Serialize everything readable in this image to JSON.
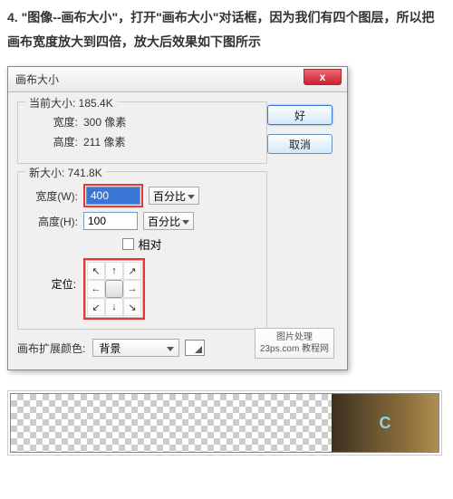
{
  "intro": "4. \"图像--画布大小\"，打开\"画布大小\"对话框，因为我们有四个图层，所以把画布宽度放大到四倍，放大后效果如下图所示",
  "dialog": {
    "title": "画布大小",
    "close": "x",
    "current": {
      "legend": "当前大小: 185.4K",
      "width_label": "宽度:",
      "width_value": "300 像素",
      "height_label": "高度:",
      "height_value": "211 像素"
    },
    "new": {
      "legend": "新大小: 741.8K",
      "width_label": "宽度(W):",
      "width_value": "400",
      "width_unit": "百分比",
      "height_label": "高度(H):",
      "height_value": "100",
      "height_unit": "百分比",
      "relative_label": "相对",
      "anchor_label": "定位:",
      "arrows": {
        "nw": "↖",
        "n": "↑",
        "ne": "↗",
        "w": "←",
        "e": "→",
        "sw": "↙",
        "s": "↓",
        "se": "↘"
      }
    },
    "extend": {
      "label": "画布扩展颜色:",
      "value": "背景"
    },
    "buttons": {
      "ok": "好",
      "cancel": "取消"
    },
    "watermark": {
      "line1": "图片处理",
      "line2": "23ps.com 教程网"
    }
  },
  "result": {
    "thumb_letter": "C"
  }
}
